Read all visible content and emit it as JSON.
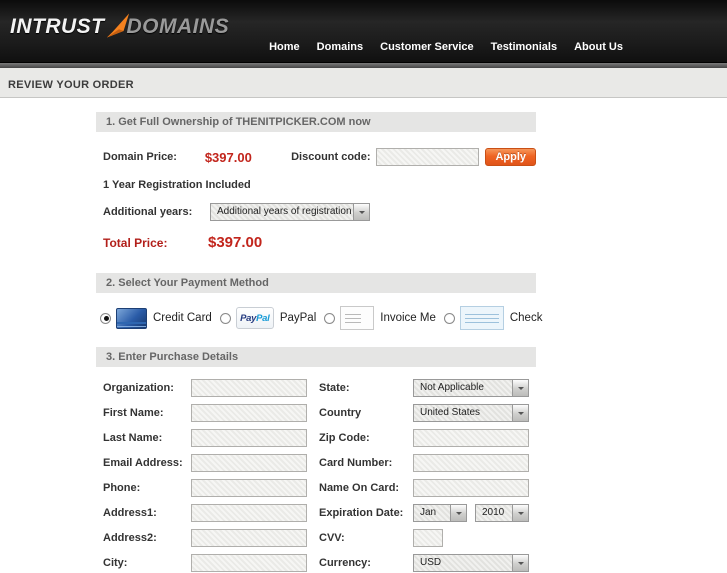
{
  "header": {
    "logo": {
      "part1": "INTRUST",
      "part2": "DOMAINS"
    },
    "nav": [
      {
        "label": "Home"
      },
      {
        "label": "Domains"
      },
      {
        "label": "Customer Service"
      },
      {
        "label": "Testimonials"
      },
      {
        "label": "About Us"
      }
    ]
  },
  "page": {
    "title": "REVIEW YOUR ORDER"
  },
  "sections": {
    "order": {
      "title": "1. Get Full Ownership of THENITPICKER.COM now",
      "domain_price_label": "Domain Price:",
      "domain_price": "$397.00",
      "discount_label": "Discount code:",
      "discount_value": "",
      "apply_label": "Apply",
      "registration_note": "1 Year Registration Included",
      "additional_years_label": "Additional years:",
      "additional_years_value": "Additional years of registration",
      "total_label": "Total Price:",
      "total_price": "$397.00"
    },
    "payment": {
      "title": "2. Select Your Payment Method",
      "paypal_logo": {
        "part1": "Pay",
        "part2": "Pal"
      },
      "methods": [
        {
          "label": "Credit Card",
          "icon": "credit-card-icon",
          "selected": true
        },
        {
          "label": "PayPal",
          "icon": "paypal-icon",
          "selected": false
        },
        {
          "label": "Invoice Me",
          "icon": "invoice-icon",
          "selected": false
        },
        {
          "label": "Check",
          "icon": "check-icon",
          "selected": false
        }
      ]
    },
    "details": {
      "title": "3. Enter Purchase Details",
      "rows": [
        {
          "left": {
            "label": "Organization:",
            "type": "input",
            "value": ""
          },
          "right": {
            "label": "State:",
            "type": "select",
            "value": "Not Applicable"
          }
        },
        {
          "left": {
            "label": "First Name:",
            "type": "input",
            "value": ""
          },
          "right": {
            "label": "Country",
            "type": "select",
            "value": "United States"
          }
        },
        {
          "left": {
            "label": "Last Name:",
            "type": "input",
            "value": ""
          },
          "right": {
            "label": "Zip Code:",
            "type": "input",
            "value": ""
          }
        },
        {
          "left": {
            "label": "Email Address:",
            "type": "input",
            "value": ""
          },
          "right": {
            "label": "Card Number:",
            "type": "input",
            "value": ""
          }
        },
        {
          "left": {
            "label": "Phone:",
            "type": "input",
            "value": ""
          },
          "right": {
            "label": "Name On Card:",
            "type": "input",
            "value": ""
          }
        },
        {
          "left": {
            "label": "Address1:",
            "type": "input",
            "value": ""
          },
          "right": {
            "label": "Expiration Date:",
            "type": "select-pair",
            "values": [
              "Jan",
              "2010"
            ]
          }
        },
        {
          "left": {
            "label": "Address2:",
            "type": "input",
            "value": ""
          },
          "right": {
            "label": "CVV:",
            "type": "input-small",
            "value": ""
          }
        },
        {
          "left": {
            "label": "City:",
            "type": "input",
            "value": ""
          },
          "right": {
            "label": "Currency:",
            "type": "select",
            "value": "USD"
          }
        }
      ]
    }
  },
  "colors": {
    "accent_orange": "#ef6423",
    "price_red": "#c2251c",
    "total_red": "#b21f1a",
    "header_bg": "#161616",
    "section_bar_bg": "#e5e5e4"
  }
}
